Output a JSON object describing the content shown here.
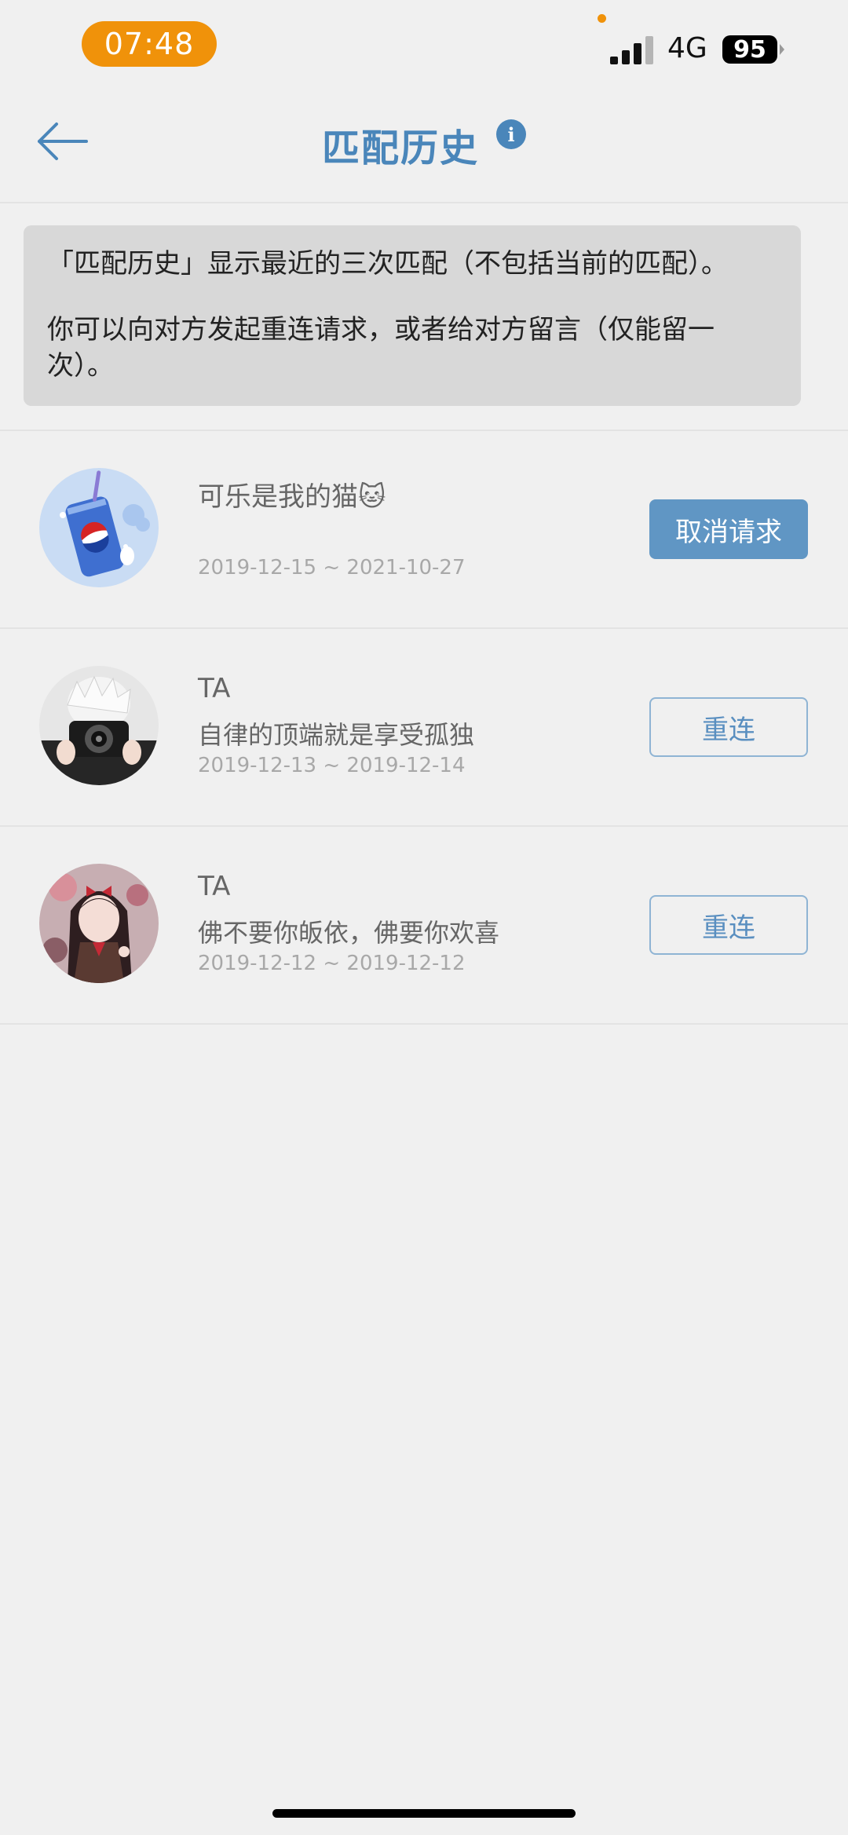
{
  "status_bar": {
    "time": "07:48",
    "network": "4G",
    "battery": "95",
    "accent_color": "#f0920a"
  },
  "header": {
    "title": "匹配历史",
    "back_icon": "arrow-left-icon",
    "info_icon": "info-icon",
    "info_glyph": "i",
    "title_color": "#4a86ba"
  },
  "notice": {
    "line1": "「匹配历史」显示最近的三次匹配（不包括当前的匹配）。",
    "line2": "你可以向对方发起重连请求，或者给对方留言（仅能留一次）。"
  },
  "history": [
    {
      "name": "可乐是我的猫🐱",
      "signature": "",
      "dates": "2019-12-15 ~ 2021-10-27",
      "button": "取消请求",
      "button_style": "filled",
      "avatar": "pepsi-can-avatar"
    },
    {
      "name": "TA",
      "signature": "自律的顶端就是享受孤独",
      "dates": "2019-12-13 ~ 2019-12-14",
      "button": "重连",
      "button_style": "outline",
      "avatar": "photographer-avatar"
    },
    {
      "name": "TA",
      "signature": "佛不要你皈依，佛要你欢喜",
      "dates": "2019-12-12 ~ 2019-12-12",
      "button": "重连",
      "button_style": "outline",
      "avatar": "anime-girl-avatar"
    }
  ]
}
